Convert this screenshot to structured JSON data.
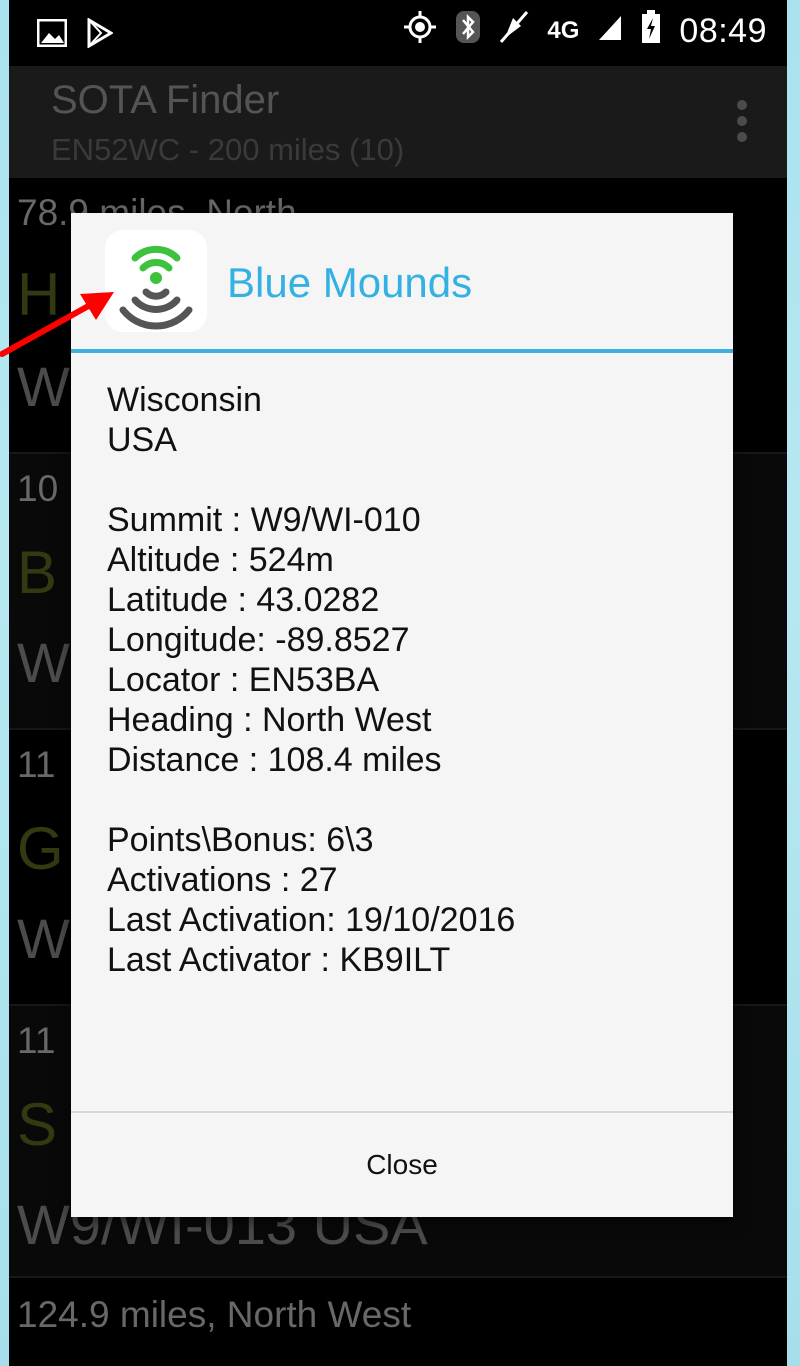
{
  "status_bar": {
    "time": "08:49",
    "network": "4G",
    "icons": [
      "image-icon",
      "play-store-icon",
      "gps-icon",
      "bluetooth-icon",
      "mute-icon",
      "signal-icon",
      "battery-icon"
    ]
  },
  "action_bar": {
    "title": "SOTA Finder",
    "subtitle": "EN52WC - 200 miles  (10)",
    "overflow_icon": "overflow-menu-icon"
  },
  "list": {
    "rows": [
      {
        "distance": "78.9 miles, North",
        "name": "H",
        "ref": "W"
      },
      {
        "distance": "10",
        "name": "B",
        "ref": "W"
      },
      {
        "distance": "11",
        "name": "G",
        "ref": "W"
      },
      {
        "distance": "11",
        "name": "S",
        "ref": "W9/WI-013  USA"
      },
      {
        "distance": "124.9 miles, North West"
      }
    ]
  },
  "dialog": {
    "title": "Blue Mounds",
    "icon": "sota-app-icon",
    "lines": [
      "Wisconsin",
      "USA",
      "",
      "Summit   : W9/WI-010",
      "Altitude   : 524m",
      "Latitude     : 43.0282",
      "Longitude: -89.8527",
      "Locator     : EN53BA",
      "Heading : North West",
      "Distance  : 108.4 miles",
      "",
      "Points\\Bonus: 6\\3",
      "Activations    : 27",
      "Last Activation: 19/10/2016",
      "Last Activator  : KB9ILT"
    ],
    "close_label": "Close"
  },
  "colors": {
    "accent": "#34b1e3",
    "dialog_bg": "#f5f5f5",
    "row_name": "#5a6b20",
    "annotation_arrow": "#ff0000"
  }
}
